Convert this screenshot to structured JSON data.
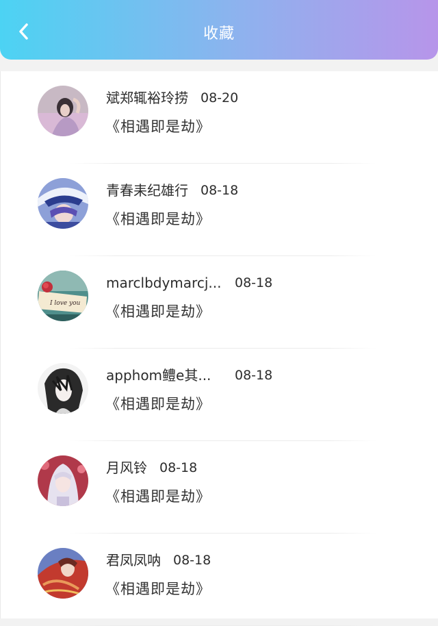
{
  "header": {
    "title": "收藏",
    "back_icon": "chevron-left-icon",
    "gradient": [
      "#4cd3f3",
      "#b795ea"
    ]
  },
  "favorites": [
    {
      "user": "斌郑辄裕玲捞",
      "date": "08-20",
      "title": "《相遇即是劫》",
      "avatar": "woman-portrait"
    },
    {
      "user": "青春耒纪雄行",
      "date": "08-18",
      "title": "《相遇即是劫》",
      "avatar": "anime-boy-hat"
    },
    {
      "user": "marclbdymarcj...",
      "date": "08-18",
      "title": "《相遇即是劫》",
      "avatar": "i-love-you-note"
    },
    {
      "user": "apphom鳢e其...",
      "date": "08-18",
      "title": "《相遇即是劫》",
      "avatar": "anime-boy-sketch"
    },
    {
      "user": "月风铃",
      "date": "08-18",
      "title": "《相遇即是劫》",
      "avatar": "anime-girl-flowers"
    },
    {
      "user": "君凤凤呐",
      "date": "08-18",
      "title": "《相遇即是劫》",
      "avatar": "anime-girl-red"
    }
  ]
}
